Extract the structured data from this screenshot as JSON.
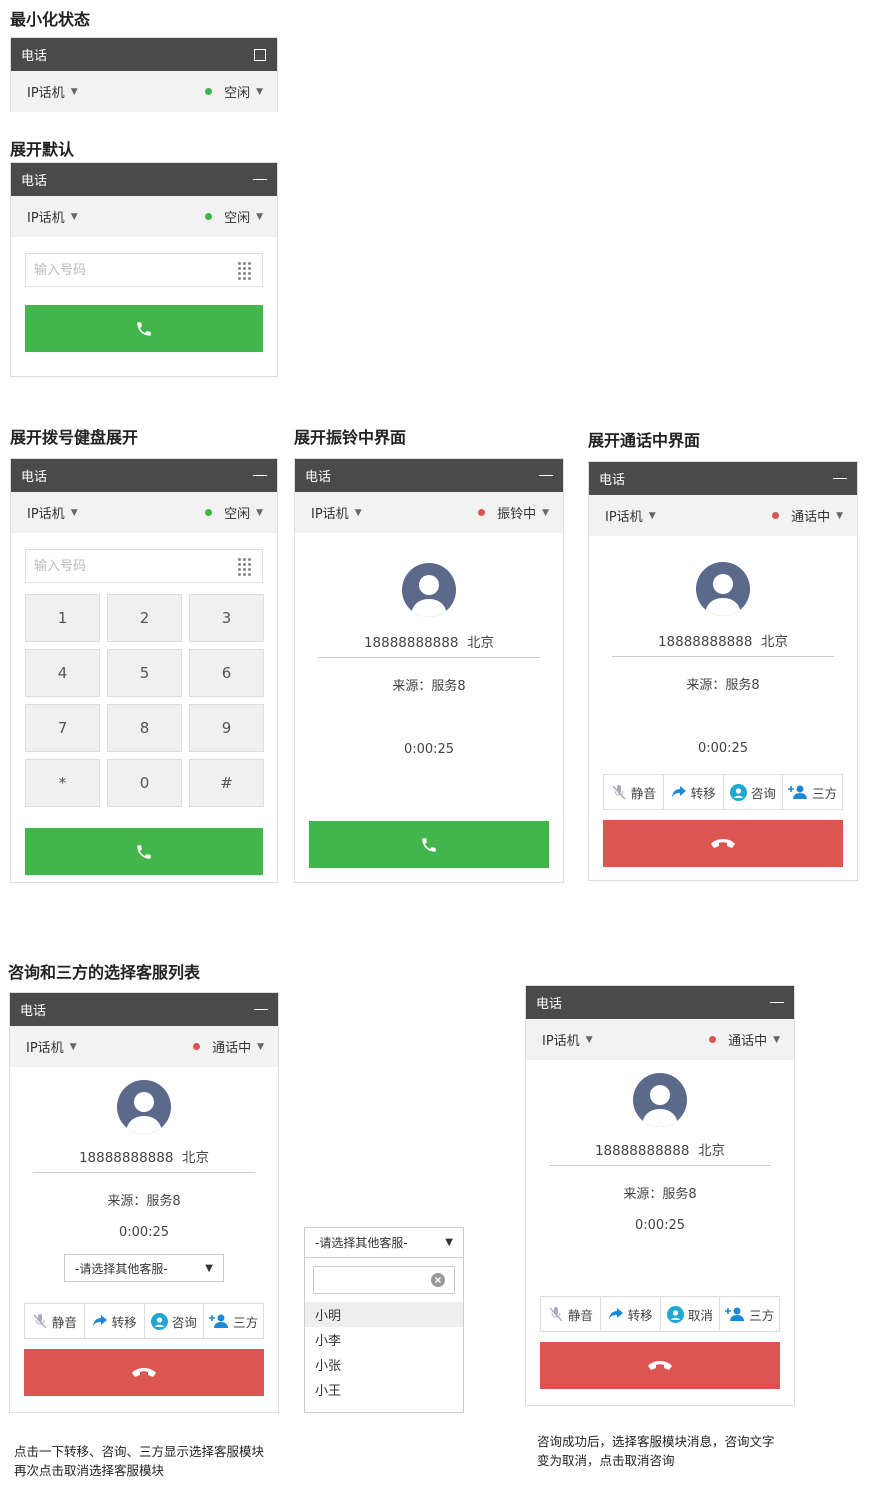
{
  "sections": {
    "minimized": "最小化状态",
    "expanded_default": "展开默认",
    "dialpad_expanded": "展开拨号健盘展开",
    "ringing": "展开振铃中界面",
    "in_call": "展开通话中界面",
    "consult_list": "咨询和三方的选择客服列表"
  },
  "panel": {
    "title": "电话",
    "device": "IP话机",
    "status_idle": "空闲",
    "status_ringing": "振铃中",
    "status_in_call": "通话中"
  },
  "dial": {
    "placeholder": "输入号码",
    "keys": [
      "1",
      "2",
      "3",
      "4",
      "5",
      "6",
      "7",
      "8",
      "9",
      "*",
      "0",
      "#"
    ]
  },
  "call": {
    "caller_number": "18888888888",
    "caller_location": "北京",
    "source": "来源：服务8",
    "duration": "0:00:25"
  },
  "actions": {
    "mute": "静音",
    "transfer": "转移",
    "consult": "咨询",
    "cancel": "取消",
    "three_way": "三方"
  },
  "agent_select": {
    "placeholder": "-请选择其他客服-",
    "options": [
      "小明",
      "小李",
      "小张",
      "小王"
    ]
  },
  "captions": {
    "left_line1": "点击一下转移、咨询、三方显示选择客服模块",
    "left_line2": "再次点击取消选择客服模块",
    "right_line1": "咨询成功后，选择客服模块消息，咨询文字",
    "right_line2": "变为取消，点击取消咨询"
  },
  "colors": {
    "header": "#4a4a4a",
    "call_green": "#42b64a",
    "hangup_red": "#dc5551",
    "idle_dot": "#3cb44b",
    "busy_dot": "#d9534f",
    "avatar": "#5b6a8a"
  }
}
